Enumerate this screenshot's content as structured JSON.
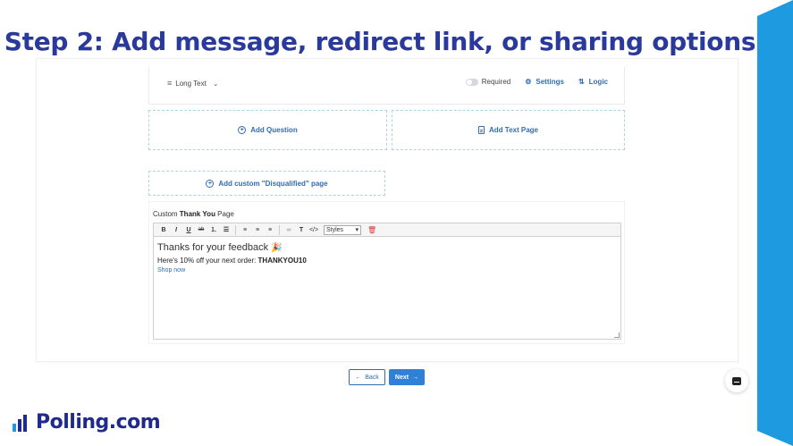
{
  "slide": {
    "headline": "Step 2: Add message, redirect link, or sharing options",
    "brand": "Polling.com",
    "accent_color": "#2a3a9c",
    "side_bar_color": "#1e9be0"
  },
  "question_bar": {
    "type_label": "Long Text",
    "required_label": "Required",
    "settings_label": "Settings",
    "logic_label": "Logic"
  },
  "actions": {
    "add_question": "Add Question",
    "add_text_page": "Add Text Page",
    "add_disqualified": "Add custom \"Disqualified\" page"
  },
  "thank_you": {
    "label_prefix": "Custom ",
    "label_bold": "Thank You",
    "label_suffix": " Page",
    "toolbar": {
      "bold": "B",
      "italic": "I",
      "underline": "U",
      "strike": "ab",
      "styles_select": "Styles"
    },
    "content": {
      "line1": "Thanks for your feedback",
      "line2_prefix": "Here's 10% off your next order: ",
      "line2_code": "THANKYOU10",
      "link": "Shop now"
    }
  },
  "navigation": {
    "back_label": "Back",
    "next_label": "Next"
  }
}
